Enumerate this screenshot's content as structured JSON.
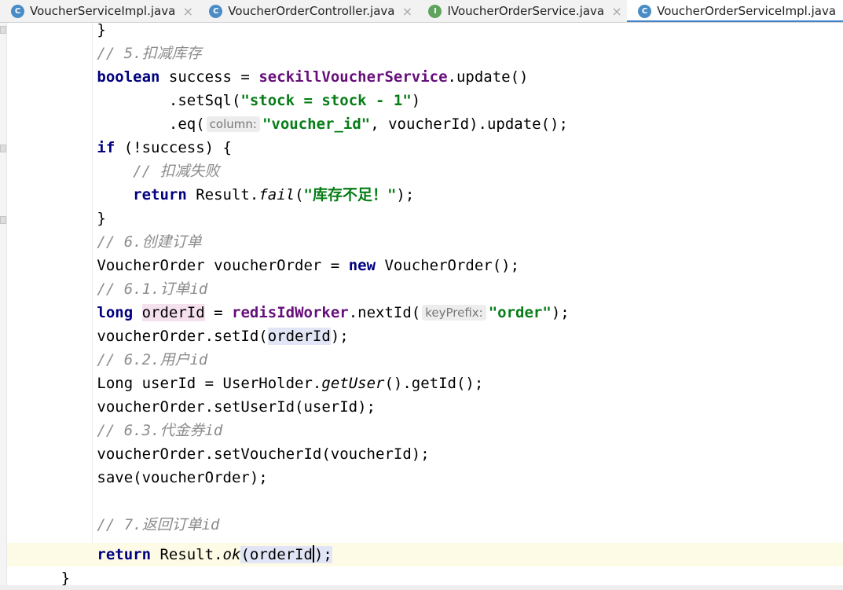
{
  "tabs": [
    {
      "label": "VoucherServiceImpl.java",
      "icon": "class-icon",
      "icon_glyph": "C",
      "active": false
    },
    {
      "label": "VoucherOrderController.java",
      "icon": "class-icon",
      "icon_glyph": "C",
      "active": false
    },
    {
      "label": "IVoucherOrderService.java",
      "icon": "interface-icon",
      "icon_glyph": "I",
      "active": false
    },
    {
      "label": "VoucherOrderServiceImpl.java",
      "icon": "class-icon",
      "icon_glyph": "C",
      "active": true
    }
  ],
  "tab_close_glyph": "×",
  "colors": {
    "keyword": "#000080",
    "string": "#067d17",
    "comment": "#8c8c8c",
    "field": "#660e7a",
    "tab_accent": "#4083c9"
  },
  "code": {
    "l1": {
      "t1": "}"
    },
    "l2": {
      "t1": "// 5.扣减库存"
    },
    "l3": {
      "t1": "boolean",
      "t2": " success = ",
      "t3": "seckillVoucherService",
      "t4": ".update()"
    },
    "l4": {
      "t1": ".setSql(",
      "t2": "\"stock = stock - 1\"",
      "t3": ")"
    },
    "l5": {
      "t1": ".eq(",
      "hint": "column:",
      "t2": "\"voucher_id\"",
      "t3": ", voucherId).update();"
    },
    "l6": {
      "t1": "if",
      "t2": " (!success) {"
    },
    "l7": {
      "t1": "// 扣减失败"
    },
    "l8": {
      "t1": "return",
      "t2": " Result.",
      "t3": "fail",
      "t4": "(",
      "t5": "\"库存不足！\"",
      "t6": ");"
    },
    "l9": {
      "t1": "}"
    },
    "l10": {
      "t1": "// 6.创建订单"
    },
    "l11": {
      "t1": "VoucherOrder voucherOrder = ",
      "t2": "new",
      "t3": " VoucherOrder();"
    },
    "l12": {
      "t1": "// 6.1.订单id"
    },
    "l13": {
      "t1": "long",
      "t2": " ",
      "t3": "orderId",
      "t4": " = ",
      "t5": "redisIdWorker",
      "t6": ".nextId(",
      "hint": "keyPrefix:",
      "t7": "\"order\"",
      "t8": ");"
    },
    "l14": {
      "t1": "voucherOrder.setId(",
      "t2": "orderId",
      "t3": ");"
    },
    "l15": {
      "t1": "// 6.2.用户id"
    },
    "l16": {
      "t1": "Long userId = UserHolder.",
      "t2": "getUser",
      "t3": "().getId();"
    },
    "l17": {
      "t1": "voucherOrder.setUserId(userId);"
    },
    "l18": {
      "t1": "// 6.3.代金券id"
    },
    "l19": {
      "t1": "voucherOrder.setVoucherId(voucherId);"
    },
    "l20": {
      "t1": "save(voucherOrder);"
    },
    "l22": {
      "t1": "// 7.返回订单id"
    },
    "l23": {
      "t1": "return",
      "t2": " Result.",
      "t3": "ok",
      "t4": "(",
      "t5": "orderId",
      "t6": ");"
    },
    "l24": {
      "t1": "}"
    }
  }
}
